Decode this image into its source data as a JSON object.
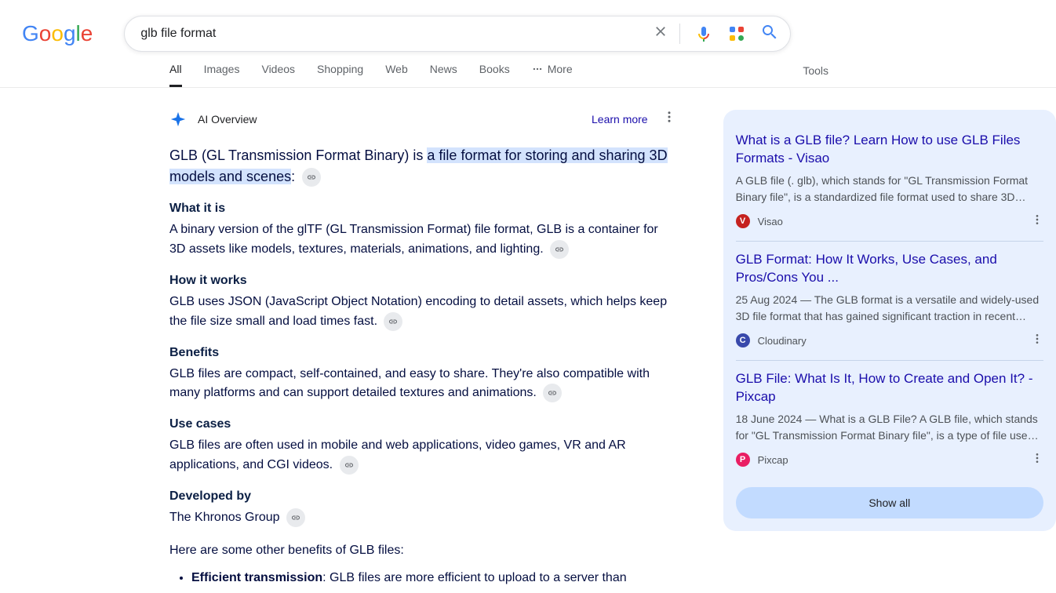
{
  "search": {
    "query": "glb file format"
  },
  "tabs": [
    "All",
    "Images",
    "Videos",
    "Shopping",
    "Web",
    "News",
    "Books"
  ],
  "more_label": "More",
  "tools_label": "Tools",
  "ai": {
    "heading": "AI Overview",
    "learn_more": "Learn more",
    "intro_prefix": "GLB (GL Transmission Format Binary) is ",
    "intro_highlight": "a file format for storing and sharing 3D models and scenes",
    "intro_suffix": ":",
    "sections": [
      {
        "title": "What it is",
        "body": "A binary version of the glTF (GL Transmission Format) file format, GLB is a container for 3D assets like models, textures, materials, animations, and lighting."
      },
      {
        "title": "How it works",
        "body": "GLB uses JSON (JavaScript Object Notation) encoding to detail assets, which helps keep the file size small and load times fast."
      },
      {
        "title": "Benefits",
        "body": "GLB files are compact, self-contained, and easy to share. They're also compatible with many platforms and can support detailed textures and animations."
      },
      {
        "title": "Use cases",
        "body": "GLB files are often used in mobile and web applications, video games, VR and AR applications, and CGI videos."
      },
      {
        "title": "Developed by",
        "body": "The Khronos Group"
      }
    ],
    "other_benefits_heading": "Here are some other benefits of GLB files:",
    "bullets": [
      {
        "strong": "Efficient transmission",
        "rest": ": GLB files are more efficient to upload to a server than"
      }
    ]
  },
  "sidebar": {
    "cards": [
      {
        "title": "What is a GLB file? Learn How to use GLB Files Formats - Visao",
        "snippet": "A GLB file (. glb), which stands for \"GL Transmission Format Binary file\", is a standardized file format used to share 3D…",
        "source": "Visao",
        "color": "#c5221f"
      },
      {
        "title": "GLB Format: How It Works, Use Cases, and Pros/Cons You ...",
        "snippet": "25 Aug 2024 — The GLB format is a versatile and widely-used 3D file format that has gained significant traction in recent…",
        "source": "Cloudinary",
        "color": "#3949ab"
      },
      {
        "title": "GLB File: What Is It, How to Create and Open It? - Pixcap",
        "snippet": "18 June 2024 — What is a GLB File? A GLB file, which stands for \"GL Transmission Format Binary file\", is a type of file use…",
        "source": "Pixcap",
        "color": "#e91e63"
      }
    ],
    "show_all": "Show all"
  }
}
